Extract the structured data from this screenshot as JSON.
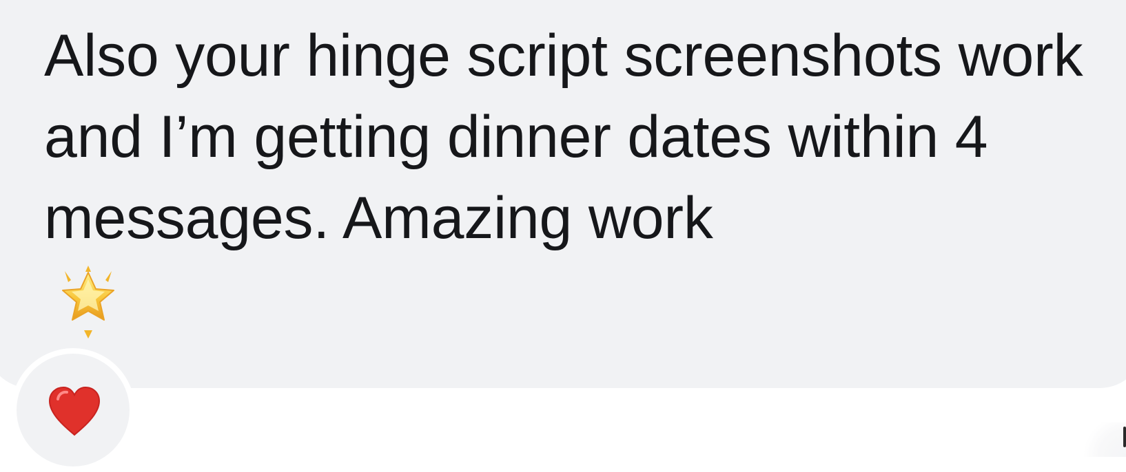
{
  "message": {
    "text": "Also your hinge script screenshots work and I’m getting dinner dates within 4 messages. Amazing work",
    "emoji_icon": "glowing-star-icon"
  },
  "reaction": {
    "icon": "red-heart-icon"
  },
  "colors": {
    "bubble_background": "#f1f2f4",
    "text": "#16171a",
    "heart": "#e0312b",
    "star": "#f7c531"
  }
}
